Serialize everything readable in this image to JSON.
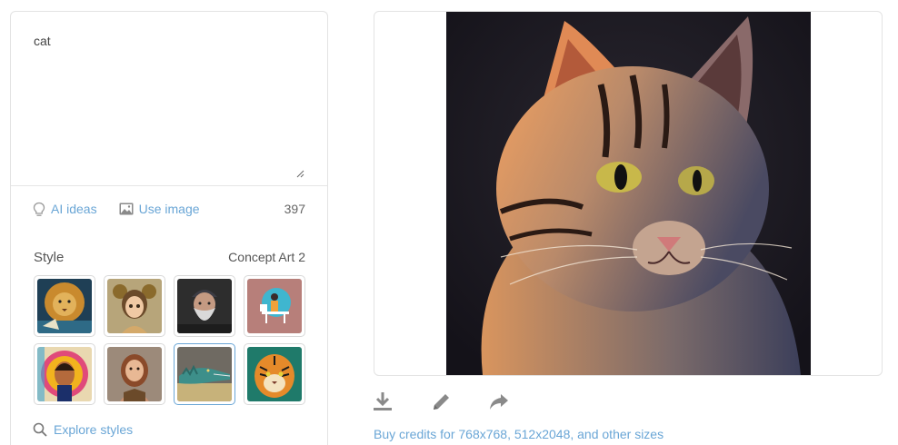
{
  "prompt": {
    "text": "cat"
  },
  "tools": {
    "ai_ideas_label": "AI ideas",
    "ai_ideas_icon": "lightbulb-icon",
    "use_image_label": "Use image",
    "use_image_icon": "image-icon",
    "char_count": "397"
  },
  "style": {
    "label": "Style",
    "selected": "Concept Art 2",
    "thumbnails": [
      {
        "subject": "lion",
        "icon": "lion-thumbnail"
      },
      {
        "subject": "fantasy girl",
        "icon": "girl-thumbnail"
      },
      {
        "subject": "bearded man",
        "icon": "man-thumbnail"
      },
      {
        "subject": "person at desk illustration",
        "icon": "desk-thumbnail"
      },
      {
        "subject": "pop art portrait",
        "icon": "popart-thumbnail"
      },
      {
        "subject": "woman portrait",
        "icon": "woman-thumbnail"
      },
      {
        "subject": "crocodile",
        "icon": "crocodile-thumbnail",
        "selected": true
      },
      {
        "subject": "tiger",
        "icon": "tiger-thumbnail"
      }
    ]
  },
  "explore": {
    "label": "Explore styles",
    "icon": "search-icon"
  },
  "result": {
    "subject": "cat",
    "icon": "cat-image"
  },
  "actions": [
    {
      "icon": "download-icon"
    },
    {
      "icon": "pencil-icon"
    },
    {
      "icon": "share-icon"
    }
  ],
  "buy_credits": "Buy credits for 768x768, 512x2048, and other sizes",
  "colors": {
    "link": "#6aa6d6",
    "border": "#e3e3e3",
    "icon_gray": "#8a8a8a"
  }
}
